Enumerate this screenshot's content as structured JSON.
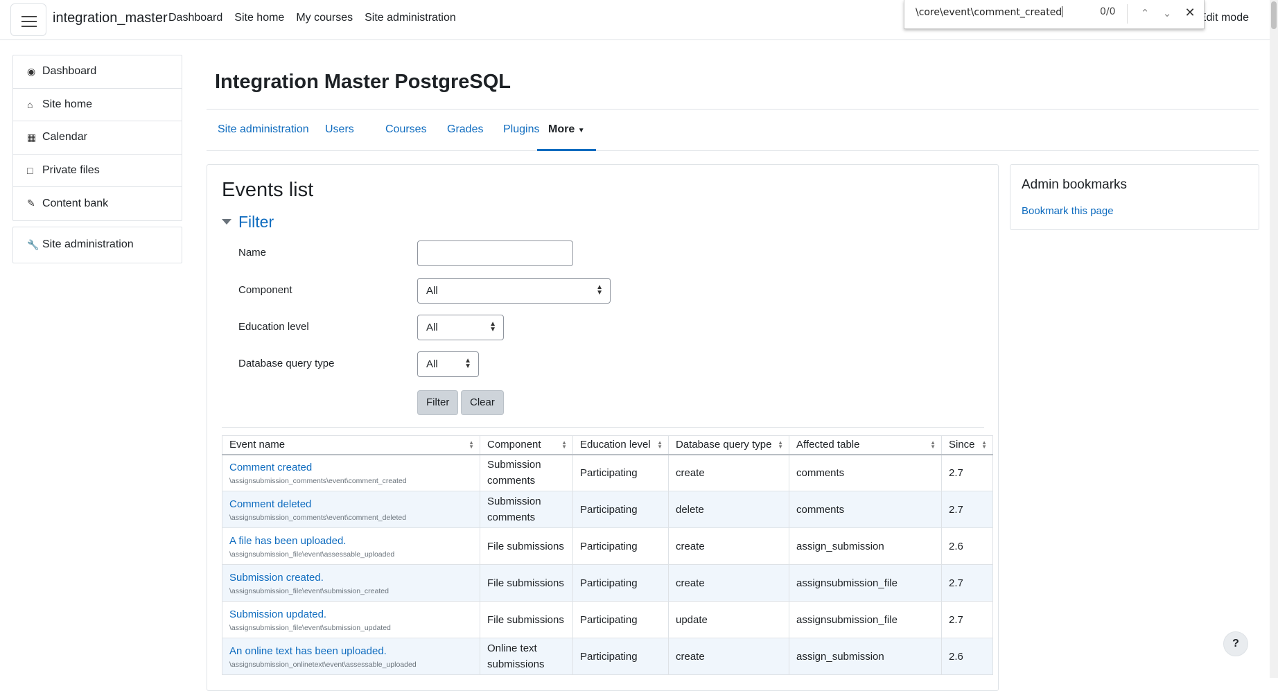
{
  "navbar": {
    "brand": "integration_master",
    "links": [
      "Dashboard",
      "Site home",
      "My courses",
      "Site administration"
    ],
    "edit_mode": "Edit mode"
  },
  "findbar": {
    "query": "\\core\\event\\comment_created",
    "count": "0/0"
  },
  "drawer": {
    "items": [
      {
        "label": "Dashboard",
        "icon": "dashboard-icon"
      },
      {
        "label": "Site home",
        "icon": "home-icon"
      },
      {
        "label": "Calendar",
        "icon": "calendar-icon"
      },
      {
        "label": "Private files",
        "icon": "file-icon"
      },
      {
        "label": "Content bank",
        "icon": "brush-icon"
      }
    ],
    "admin": {
      "label": "Site administration",
      "icon": "wrench-icon"
    }
  },
  "header": {
    "title": "Integration Master PostgreSQL"
  },
  "tabs": [
    "Site administration",
    "Users",
    "Courses",
    "Grades",
    "Plugins",
    "More"
  ],
  "main": {
    "title": "Events list",
    "filter_legend": "Filter",
    "fields": {
      "name_label": "Name",
      "component_label": "Component",
      "component_value": "All",
      "edulevel_label": "Education level",
      "edulevel_value": "All",
      "crud_label": "Database query type",
      "crud_value": "All"
    },
    "filter_button": "Filter",
    "clear_button": "Clear"
  },
  "table": {
    "headers": [
      "Event name",
      "Component",
      "Education level",
      "Database query type",
      "Affected table",
      "Since"
    ],
    "rows": [
      {
        "name": "Comment created",
        "class": "\\assignsubmission_comments\\event\\comment_created",
        "component": "Submission comments",
        "level": "Participating",
        "crud": "create",
        "table": "comments",
        "since": "2.7"
      },
      {
        "name": "Comment deleted",
        "class": "\\assignsubmission_comments\\event\\comment_deleted",
        "component": "Submission comments",
        "level": "Participating",
        "crud": "delete",
        "table": "comments",
        "since": "2.7"
      },
      {
        "name": "A file has been uploaded.",
        "class": "\\assignsubmission_file\\event\\assessable_uploaded",
        "component": "File submissions",
        "level": "Participating",
        "crud": "create",
        "table": "assign_submission",
        "since": "2.6"
      },
      {
        "name": "Submission created.",
        "class": "\\assignsubmission_file\\event\\submission_created",
        "component": "File submissions",
        "level": "Participating",
        "crud": "create",
        "table": "assignsubmission_file",
        "since": "2.7"
      },
      {
        "name": "Submission updated.",
        "class": "\\assignsubmission_file\\event\\submission_updated",
        "component": "File submissions",
        "level": "Participating",
        "crud": "update",
        "table": "assignsubmission_file",
        "since": "2.7"
      },
      {
        "name": "An online text has been uploaded.",
        "class": "\\assignsubmission_onlinetext\\event\\assessable_uploaded",
        "component": "Online text submissions",
        "level": "Participating",
        "crud": "create",
        "table": "assign_submission",
        "since": "2.6"
      }
    ]
  },
  "block": {
    "title": "Admin bookmarks",
    "link": "Bookmark this page"
  },
  "help": "?",
  "colors": {
    "link": "#0f6cbf",
    "stripe": "#f0f6fc",
    "border": "#dee2e6"
  }
}
